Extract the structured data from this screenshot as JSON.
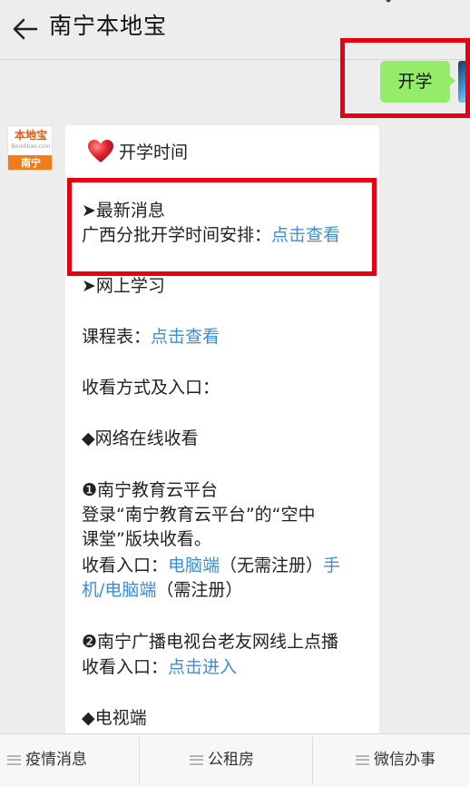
{
  "header": {
    "title": "南宁本地宝"
  },
  "sent_message": {
    "text": "开学"
  },
  "brand_avatar": {
    "name_cn": "本地宝",
    "url": "Bendibao.com",
    "city": "南宁"
  },
  "card": {
    "heading": "开学时间",
    "latest": {
      "title": "➤最新消息",
      "text": "广西分批开学时间安排：",
      "link": "点击查看"
    },
    "online": {
      "title": "➤网上学习"
    },
    "schedule": {
      "label": "课程表：",
      "link": "点击查看"
    },
    "watch_methods": "收看方式及入口：",
    "network": "◆网络在线收看",
    "platform1": {
      "title": "❶南宁教育云平台",
      "desc_line1": "登录“南宁教育云平台”的“空中",
      "desc_line2": "课堂”版块收看。",
      "entry_label": "收看入口：",
      "link_pc": "电脑端",
      "note_free": "（无需注册）",
      "link_mobile_part1": "手",
      "link_mobile_part2": "机/电脑端",
      "note_register": "（需注册）"
    },
    "platform2": {
      "title": "❷南宁广播电视台老友网线上点播",
      "entry_label": "收看入口：",
      "link": "点击进入"
    },
    "tv": "◆电视端"
  },
  "tabbar": {
    "items": [
      "疫情消息",
      "公租房",
      "微信办事"
    ]
  }
}
